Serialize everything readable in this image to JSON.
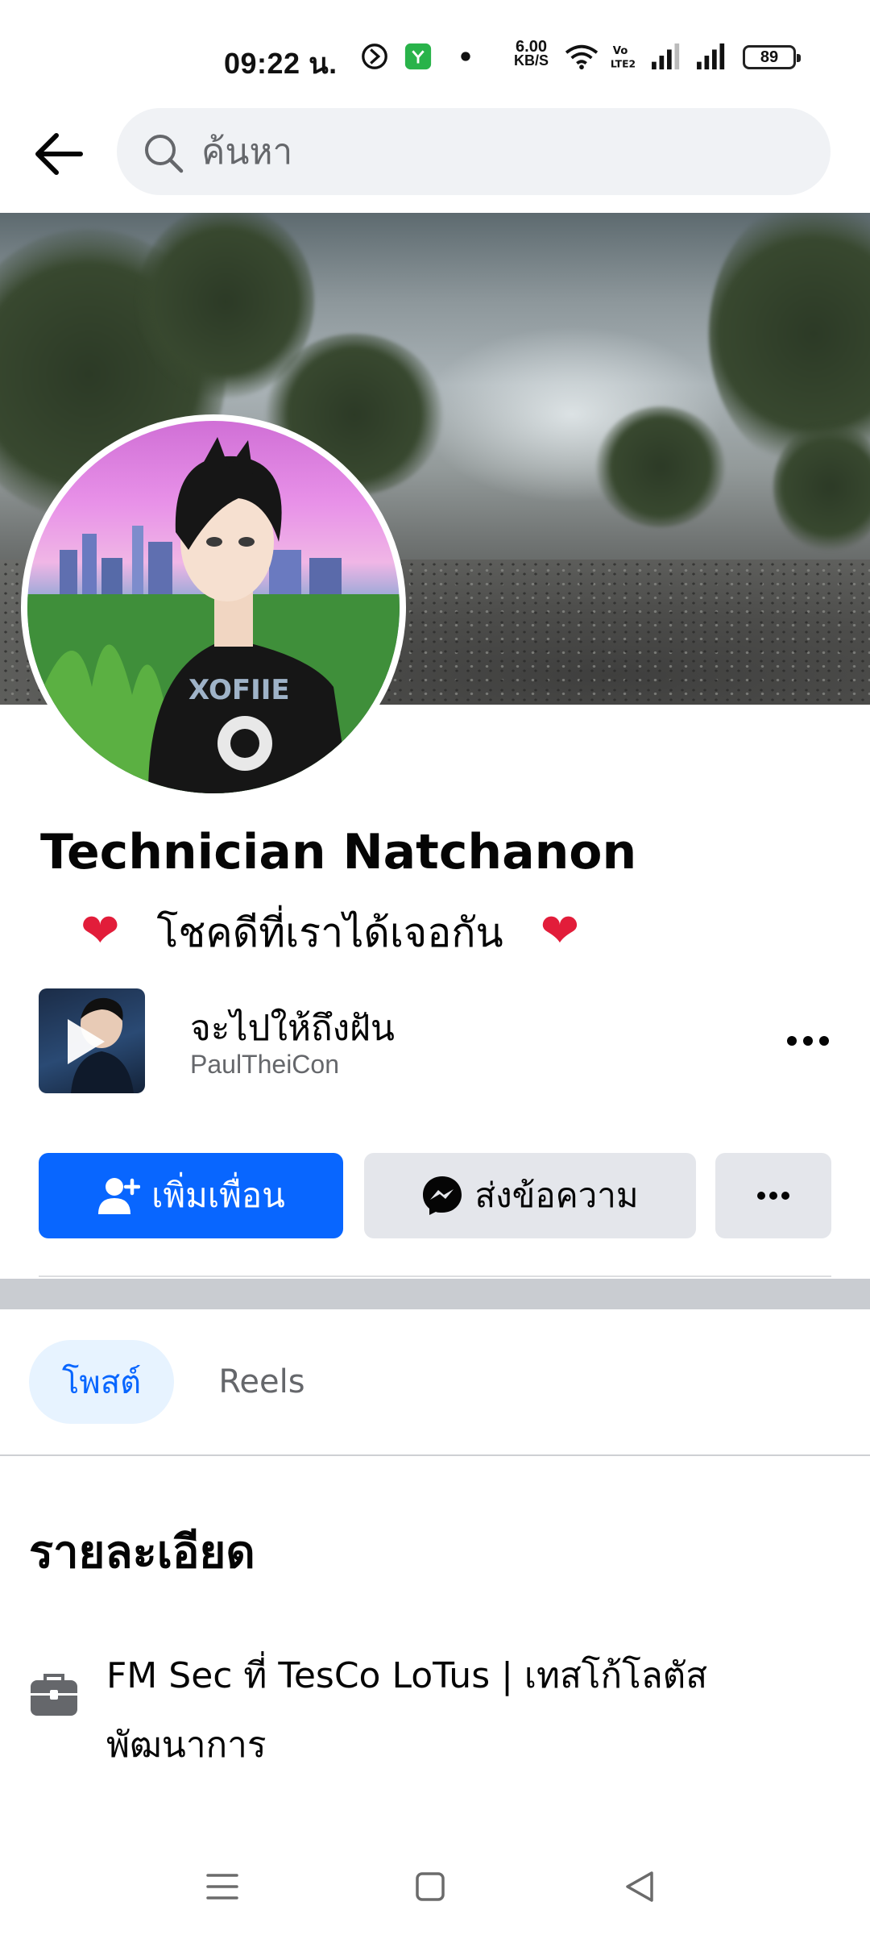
{
  "status_bar": {
    "time": "09:22 น.",
    "net_speed_value": "6.00",
    "net_speed_unit": "KB/S",
    "battery": "89"
  },
  "header": {
    "search_placeholder": "ค้นหา"
  },
  "profile": {
    "name": "Technician Natchanon",
    "bio_text": "โชคดีที่เราได้เจอกัน",
    "heart": "❤"
  },
  "music": {
    "title": "จะไปให้ถึงฝัน",
    "artist": "PaulTheiCon"
  },
  "actions": {
    "add_friend": "เพิ่มเพื่อน",
    "message": "ส่งข้อความ"
  },
  "tabs": [
    {
      "label": "โพสต์",
      "active": true
    },
    {
      "label": "Reels",
      "active": false
    }
  ],
  "details": {
    "title": "รายละเอียด",
    "work_line1": "FM Sec ที่ TesCo LoTus | เทสโก้โลตัส",
    "work_line2": "พัฒนาการ"
  },
  "colors": {
    "primary": "#0866ff",
    "secondary_button": "#e4e6eb",
    "heart": "#e21d3a",
    "tab_active_bg": "#e7f3ff"
  }
}
